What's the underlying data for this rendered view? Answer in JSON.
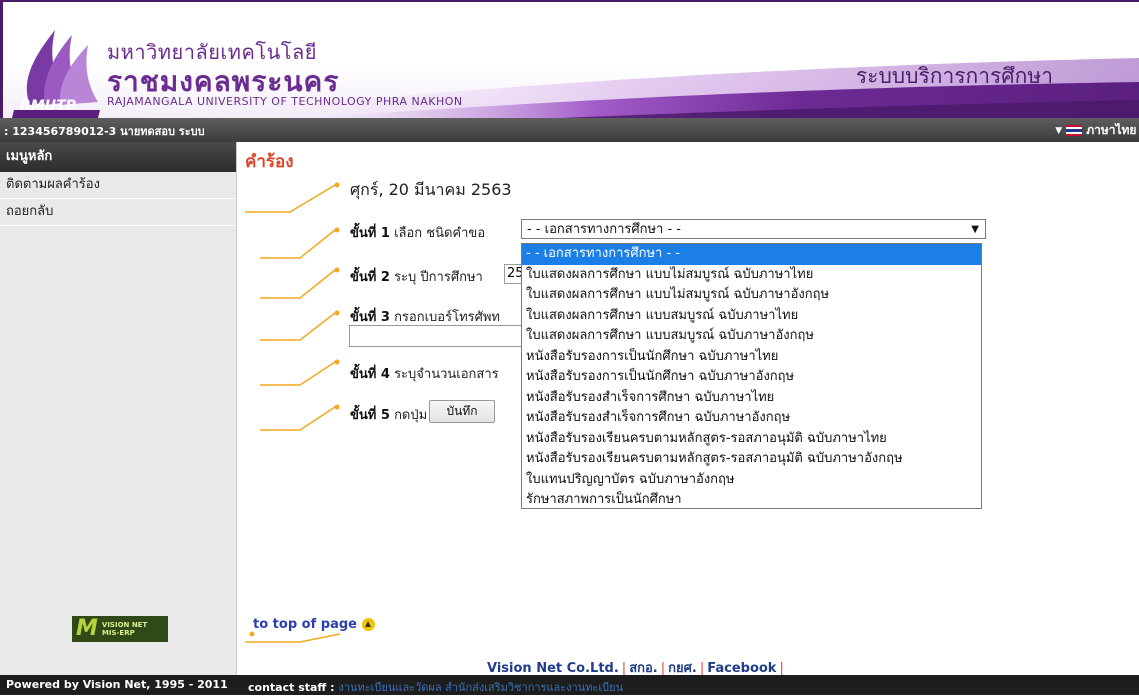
{
  "header": {
    "university_th_line1": "มหาวิทยาลัยเทคโนโลยี",
    "university_th_line2": "ราชมงคลพระนคร",
    "university_en": "RAJAMANGALA UNIVERSITY  OF TECHNOLOGY PHRA NAKHON",
    "logo_abbr": "RMUTP",
    "system_title": "ระบบบริการการศึกษา"
  },
  "userbar": {
    "user": ": 123456789012-3 นายทดสอบ ระบบ",
    "language": "ภาษาไทย"
  },
  "sidebar": {
    "title": "เมนูหลัก",
    "items": [
      {
        "label": "ติดตามผลคำร้อง"
      },
      {
        "label": "ถอยกลับ"
      }
    ],
    "logo_text": "VISION NET MIS-ERP"
  },
  "main": {
    "title": "คำร้อง",
    "date": "ศุกร์, 20 มีนาคม 2563",
    "step1": {
      "label": "ขั้นที่ 1",
      "text": "เลือก ชนิดคำขอ"
    },
    "step2": {
      "label": "ขั้นที่ 2",
      "text": "ระบุ ปีการศึกษา",
      "value": "25"
    },
    "step3": {
      "label": "ขั้นที่ 3",
      "text": "กรอกเบอร์โทรศัพท"
    },
    "step4": {
      "label": "ขั้นที่ 4",
      "text": "ระบุจำนวนเอกสาร"
    },
    "step5": {
      "label": "ขั้นที่ 5",
      "text": "กดปุ่ม",
      "button": "บันทึก"
    },
    "select": {
      "selected": "- - เอกสารทางการศึกษา - -",
      "options": [
        "- - เอกสารทางการศึกษา - -",
        "ใบแสดงผลการศึกษา แบบไม่สมบูรณ์ ฉบับภาษาไทย",
        "ใบแสดงผลการศึกษา แบบไม่สมบูรณ์ ฉบับภาษาอังกฤษ",
        "ใบแสดงผลการศึกษา แบบสมบูรณ์ ฉบับภาษาไทย",
        "ใบแสดงผลการศึกษา แบบสมบูรณ์ ฉบับภาษาอังกฤษ",
        "หนังสือรับรองการเป็นนักศึกษา ฉบับภาษาไทย",
        "หนังสือรับรองการเป็นนักศึกษา ฉบับภาษาอังกฤษ",
        "หนังสือรับรองสำเร็จการศึกษา ฉบับภาษาไทย",
        "หนังสือรับรองสำเร็จการศึกษา ฉบับภาษาอังกฤษ",
        "หนังสือรับรองเรียนครบตามหลักสูตร-รอสภาอนุมัติ ฉบับภาษาไทย",
        "หนังสือรับรองเรียนครบตามหลักสูตร-รอสภาอนุมัติ ฉบับภาษาอังกฤษ",
        "ใบแทนปริญญาบัตร ฉบับภาษาอังกฤษ",
        "รักษาสภาพการเป็นนักศึกษา"
      ]
    },
    "top_link": "to top of page"
  },
  "footer": {
    "links": [
      "Vision Net Co.Ltd.",
      "สกอ.",
      "กยศ.",
      "Facebook"
    ],
    "powered": "Powered by Vision Net, 1995 - 2011",
    "contact_label": "contact staff :",
    "contact_value": "งานทะเบียนและวัดผล สำนักส่งเสริมวิชาการและงานทะเบียน"
  },
  "colors": {
    "brand_purple": "#6b2c91",
    "title_red": "#e0462e",
    "connector_orange": "#f2a91e",
    "selection_blue": "#1c7fe6"
  }
}
